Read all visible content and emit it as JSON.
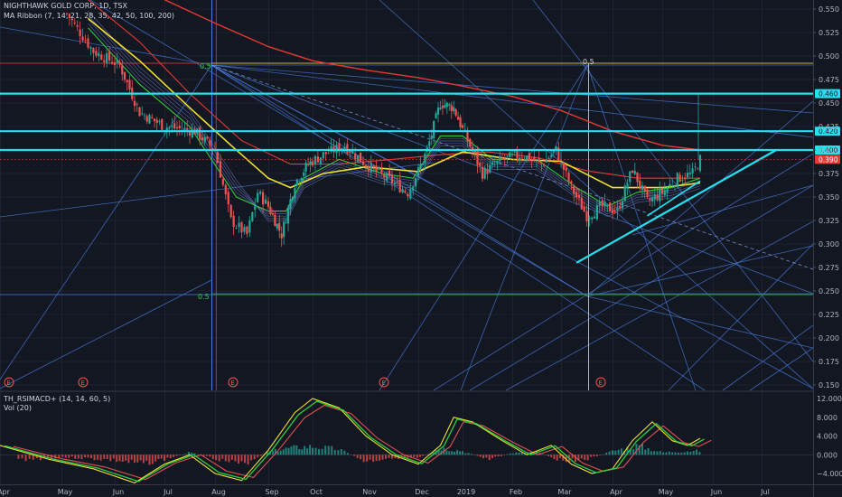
{
  "header": {
    "symbol_line": "NIGHTHAWK GOLD CORP, 1D, TSX",
    "indicator_line": "MA Ribbon (7, 14, 21, 28, 35, 42, 50, 100, 200)"
  },
  "lower_pane": {
    "indicator_line": "TH_RSIMACD+ (14, 14, 60, 5)",
    "volume_line": "Vol (20)"
  },
  "colors": {
    "background": "#131722",
    "cyan": "#26e0f0",
    "fib_blue": "#4a7fe0",
    "ma_red": "#e53935",
    "ma_yellow": "#f0e030",
    "ma_green": "#2ecc40",
    "up": "#26a69a",
    "down": "#ef5350"
  },
  "chart_data": [
    {
      "type": "candlestick",
      "price_axis": {
        "ticks": [
          0.55,
          0.525,
          0.5,
          0.475,
          0.45,
          0.425,
          0.4,
          0.375,
          0.35,
          0.325,
          0.3,
          0.275,
          0.25,
          0.225,
          0.2,
          0.175,
          0.15
        ],
        "labels": [
          "0.550",
          "0.525",
          "0.500",
          "0.475",
          "0.450",
          "0.425",
          "0.400",
          "0.375",
          "0.350",
          "0.325",
          "0.300",
          "0.275",
          "0.250",
          "0.225",
          "0.200",
          "0.175",
          "0.150"
        ],
        "range": [
          0.145,
          0.556
        ]
      },
      "time_axis": [
        "Apr",
        "May",
        "Jun",
        "Jul",
        "Aug",
        "Sep",
        "Oct",
        "Nov",
        "Dec",
        "2019",
        "Feb",
        "Mar",
        "Apr",
        "May",
        "Jun",
        "Jul"
      ],
      "horizontal_levels": [
        {
          "value": 0.46,
          "label": "0.460"
        },
        {
          "value": 0.42,
          "label": "0.420"
        },
        {
          "value": 0.4,
          "label": "0.400"
        }
      ],
      "last_price": {
        "value": 0.39,
        "label": "0.390"
      },
      "fib_labels": [
        "0.5",
        "0.5"
      ],
      "earnings_marker": "E",
      "price_path": [
        {
          "m": 1.1,
          "p": 0.545
        },
        {
          "m": 1.6,
          "p": 0.505
        },
        {
          "m": 2.1,
          "p": 0.49
        },
        {
          "m": 2.5,
          "p": 0.44
        },
        {
          "m": 3.0,
          "p": 0.425
        },
        {
          "m": 3.6,
          "p": 0.42
        },
        {
          "m": 4.0,
          "p": 0.4
        },
        {
          "m": 4.3,
          "p": 0.325
        },
        {
          "m": 4.6,
          "p": 0.31
        },
        {
          "m": 4.8,
          "p": 0.355
        },
        {
          "m": 5.0,
          "p": 0.34
        },
        {
          "m": 5.3,
          "p": 0.31
        },
        {
          "m": 5.6,
          "p": 0.365
        },
        {
          "m": 5.9,
          "p": 0.385
        },
        {
          "m": 6.2,
          "p": 0.395
        },
        {
          "m": 6.6,
          "p": 0.405
        },
        {
          "m": 7.0,
          "p": 0.385
        },
        {
          "m": 7.4,
          "p": 0.37
        },
        {
          "m": 7.8,
          "p": 0.355
        },
        {
          "m": 8.2,
          "p": 0.4
        },
        {
          "m": 8.5,
          "p": 0.45
        },
        {
          "m": 8.8,
          "p": 0.445
        },
        {
          "m": 9.1,
          "p": 0.41
        },
        {
          "m": 9.4,
          "p": 0.375
        },
        {
          "m": 9.8,
          "p": 0.39
        },
        {
          "m": 10.2,
          "p": 0.395
        },
        {
          "m": 10.6,
          "p": 0.385
        },
        {
          "m": 10.9,
          "p": 0.4
        },
        {
          "m": 11.2,
          "p": 0.36
        },
        {
          "m": 11.5,
          "p": 0.33
        },
        {
          "m": 11.8,
          "p": 0.34
        },
        {
          "m": 12.1,
          "p": 0.335
        },
        {
          "m": 12.4,
          "p": 0.38
        },
        {
          "m": 12.7,
          "p": 0.345
        },
        {
          "m": 13.0,
          "p": 0.355
        },
        {
          "m": 13.3,
          "p": 0.37
        },
        {
          "m": 13.6,
          "p": 0.375
        },
        {
          "m": 13.75,
          "p": 0.39
        }
      ],
      "ma_200": [
        {
          "m": 2.0,
          "p": 0.58
        },
        {
          "m": 3.0,
          "p": 0.56
        },
        {
          "m": 4.0,
          "p": 0.535
        },
        {
          "m": 5.0,
          "p": 0.51
        },
        {
          "m": 6.0,
          "p": 0.495
        },
        {
          "m": 7.0,
          "p": 0.485
        },
        {
          "m": 8.0,
          "p": 0.477
        },
        {
          "m": 9.0,
          "p": 0.468
        },
        {
          "m": 10.0,
          "p": 0.457
        },
        {
          "m": 11.0,
          "p": 0.442
        },
        {
          "m": 12.0,
          "p": 0.42
        },
        {
          "m": 13.0,
          "p": 0.405
        },
        {
          "m": 13.75,
          "p": 0.4
        }
      ],
      "ma_100": [
        {
          "m": 1.5,
          "p": 0.56
        },
        {
          "m": 2.5,
          "p": 0.515
        },
        {
          "m": 3.5,
          "p": 0.46
        },
        {
          "m": 4.5,
          "p": 0.41
        },
        {
          "m": 5.5,
          "p": 0.385
        },
        {
          "m": 6.5,
          "p": 0.385
        },
        {
          "m": 7.5,
          "p": 0.39
        },
        {
          "m": 8.5,
          "p": 0.395
        },
        {
          "m": 9.5,
          "p": 0.398
        },
        {
          "m": 10.5,
          "p": 0.392
        },
        {
          "m": 11.5,
          "p": 0.378
        },
        {
          "m": 12.5,
          "p": 0.37
        },
        {
          "m": 13.75,
          "p": 0.37
        }
      ],
      "ma_50": [
        {
          "m": 1.5,
          "p": 0.54
        },
        {
          "m": 2.5,
          "p": 0.495
        },
        {
          "m": 3.5,
          "p": 0.445
        },
        {
          "m": 4.3,
          "p": 0.405
        },
        {
          "m": 5.0,
          "p": 0.37
        },
        {
          "m": 5.5,
          "p": 0.36
        },
        {
          "m": 6.2,
          "p": 0.375
        },
        {
          "m": 7.0,
          "p": 0.382
        },
        {
          "m": 8.0,
          "p": 0.377
        },
        {
          "m": 9.0,
          "p": 0.398
        },
        {
          "m": 10.0,
          "p": 0.39
        },
        {
          "m": 11.0,
          "p": 0.388
        },
        {
          "m": 12.0,
          "p": 0.36
        },
        {
          "m": 13.0,
          "p": 0.36
        },
        {
          "m": 13.75,
          "p": 0.365
        }
      ],
      "ma_21": [
        {
          "m": 1.5,
          "p": 0.53
        },
        {
          "m": 2.5,
          "p": 0.47
        },
        {
          "m": 3.5,
          "p": 0.425
        },
        {
          "m": 4.4,
          "p": 0.35
        },
        {
          "m": 5.0,
          "p": 0.335
        },
        {
          "m": 5.4,
          "p": 0.335
        },
        {
          "m": 5.8,
          "p": 0.37
        },
        {
          "m": 6.5,
          "p": 0.39
        },
        {
          "m": 7.3,
          "p": 0.375
        },
        {
          "m": 7.9,
          "p": 0.37
        },
        {
          "m": 8.5,
          "p": 0.415
        },
        {
          "m": 9.0,
          "p": 0.415
        },
        {
          "m": 9.6,
          "p": 0.39
        },
        {
          "m": 10.5,
          "p": 0.39
        },
        {
          "m": 11.3,
          "p": 0.36
        },
        {
          "m": 11.9,
          "p": 0.34
        },
        {
          "m": 12.5,
          "p": 0.355
        },
        {
          "m": 13.2,
          "p": 0.36
        },
        {
          "m": 13.75,
          "p": 0.37
        }
      ]
    },
    {
      "type": "oscillator",
      "value_axis": {
        "ticks": [
          12,
          8,
          4,
          0,
          -4
        ],
        "labels": [
          "12.000",
          "8.000",
          "4.000",
          "0.000",
          "−4.000"
        ],
        "range": [
          -6.0,
          13.0
        ]
      },
      "fast_line": [
        {
          "m": 0.0,
          "v": 2.0
        },
        {
          "m": 0.8,
          "v": -1.0
        },
        {
          "m": 1.6,
          "v": -3.0
        },
        {
          "m": 2.4,
          "v": -6.0
        },
        {
          "m": 3.0,
          "v": -2.0
        },
        {
          "m": 3.5,
          "v": 0.0
        },
        {
          "m": 4.0,
          "v": -4.0
        },
        {
          "m": 4.5,
          "v": -5.5
        },
        {
          "m": 5.0,
          "v": 1.0
        },
        {
          "m": 5.6,
          "v": 9.0
        },
        {
          "m": 6.0,
          "v": 12.0
        },
        {
          "m": 6.5,
          "v": 10.0
        },
        {
          "m": 7.0,
          "v": 4.0
        },
        {
          "m": 7.5,
          "v": 0.0
        },
        {
          "m": 8.0,
          "v": -2.0
        },
        {
          "m": 8.5,
          "v": 2.0
        },
        {
          "m": 8.8,
          "v": 8.0
        },
        {
          "m": 9.2,
          "v": 7.0
        },
        {
          "m": 9.8,
          "v": 3.0
        },
        {
          "m": 10.3,
          "v": 0.0
        },
        {
          "m": 10.8,
          "v": 2.0
        },
        {
          "m": 11.2,
          "v": -2.0
        },
        {
          "m": 11.6,
          "v": -4.0
        },
        {
          "m": 12.0,
          "v": -3.0
        },
        {
          "m": 12.4,
          "v": 3.0
        },
        {
          "m": 12.8,
          "v": 7.0
        },
        {
          "m": 13.2,
          "v": 3.0
        },
        {
          "m": 13.5,
          "v": 2.0
        },
        {
          "m": 13.75,
          "v": 3.5
        }
      ],
      "histogram": [
        {
          "m": 0.5,
          "v": -1.0
        },
        {
          "m": 1.0,
          "v": -0.5
        },
        {
          "m": 1.5,
          "v": -0.8
        },
        {
          "m": 2.0,
          "v": -1.2
        },
        {
          "m": 2.5,
          "v": -2.0
        },
        {
          "m": 3.0,
          "v": -1.0
        },
        {
          "m": 3.5,
          "v": 0.5
        },
        {
          "m": 4.0,
          "v": -0.8
        },
        {
          "m": 4.5,
          "v": -2.2
        },
        {
          "m": 5.0,
          "v": 0.6
        },
        {
          "m": 5.5,
          "v": 1.5
        },
        {
          "m": 6.0,
          "v": 1.8
        },
        {
          "m": 6.5,
          "v": 1.2
        },
        {
          "m": 7.0,
          "v": -1.5
        },
        {
          "m": 7.5,
          "v": -0.6
        },
        {
          "m": 8.0,
          "v": -0.8
        },
        {
          "m": 8.5,
          "v": 1.5
        },
        {
          "m": 9.0,
          "v": 0.8
        },
        {
          "m": 9.5,
          "v": -1.0
        },
        {
          "m": 10.0,
          "v": 0.4
        },
        {
          "m": 10.5,
          "v": 0.6
        },
        {
          "m": 11.0,
          "v": -1.2
        },
        {
          "m": 11.5,
          "v": -1.0
        },
        {
          "m": 12.0,
          "v": 0.8
        },
        {
          "m": 12.5,
          "v": 2.0
        },
        {
          "m": 13.0,
          "v": 0.5
        },
        {
          "m": 13.5,
          "v": 0.8
        }
      ]
    }
  ]
}
